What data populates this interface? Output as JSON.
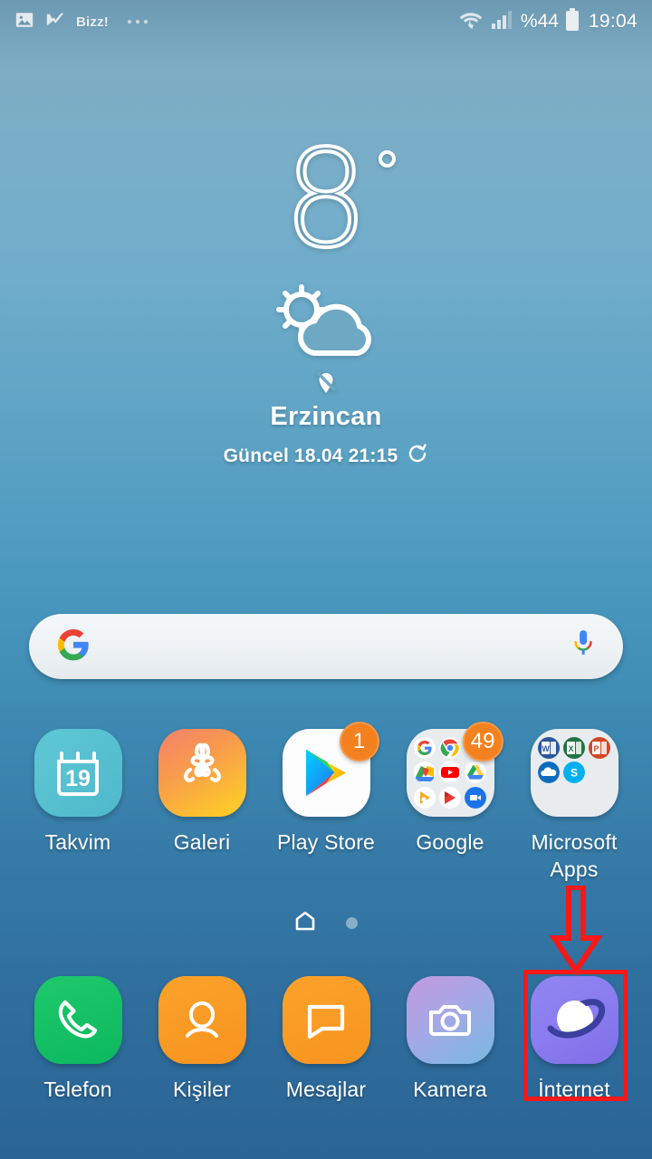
{
  "statusbar": {
    "notif_icons": [
      "image-icon",
      "bizz-check-icon"
    ],
    "notif_label": "Bizz!",
    "overflow": "three-dots-icon",
    "wifi_icon": "wifi-transfer-icon",
    "signal_icon": "cellular-signal-icon",
    "battery_percent": "%44",
    "battery_icon": "battery-icon",
    "clock": "19:04"
  },
  "weather": {
    "temperature": "8",
    "degree_symbol": "°",
    "condition_icon": "partly-cloudy-day-icon",
    "location_icon": "location-off-icon",
    "city": "Erzincan",
    "updated_text": "Güncel 18.04 21:15",
    "refresh_icon": "refresh-icon"
  },
  "search": {
    "logo_icon": "google-g-icon",
    "mic_icon": "google-mic-icon",
    "placeholder": "",
    "value": ""
  },
  "apps": [
    {
      "name": "Takvim",
      "icon": "calendar-icon",
      "day": "19",
      "badge": ""
    },
    {
      "name": "Galeri",
      "icon": "gallery-flower-icon",
      "badge": ""
    },
    {
      "name": "Play Store",
      "icon": "play-store-icon",
      "badge": "1"
    },
    {
      "name": "Google",
      "icon": "folder-google-icon",
      "badge": "49",
      "folder_items": [
        "google-search-icon",
        "chrome-icon",
        "gmail-icon",
        "maps-icon",
        "youtube-icon",
        "drive-icon",
        "play-music-icon",
        "play-movies-icon",
        "duo-icon"
      ]
    },
    {
      "name": "Microsoft Apps",
      "icon": "folder-microsoft-icon",
      "badge": "",
      "folder_items": [
        "word-icon",
        "excel-icon",
        "powerpoint-icon",
        "onedrive-icon",
        "skype-icon"
      ]
    }
  ],
  "pager": {
    "home_icon": "home-page-icon",
    "dots": 1,
    "active_index": 0
  },
  "dock": [
    {
      "name": "Telefon",
      "icon": "phone-icon"
    },
    {
      "name": "Kişiler",
      "icon": "contacts-icon"
    },
    {
      "name": "Mesajlar",
      "icon": "messages-icon"
    },
    {
      "name": "Kamera",
      "icon": "camera-icon"
    },
    {
      "name": "İnternet",
      "icon": "internet-browser-icon"
    }
  ],
  "annotation": {
    "highlight_target": "İnternet",
    "highlight_color": "#f71818",
    "arrow_icon": "down-arrow-annotation"
  },
  "colors": {
    "accent_badge": "#f4811f",
    "annotation_red": "#f71818",
    "bg_top": "#7eadc4",
    "bg_bottom": "#2a6496"
  }
}
